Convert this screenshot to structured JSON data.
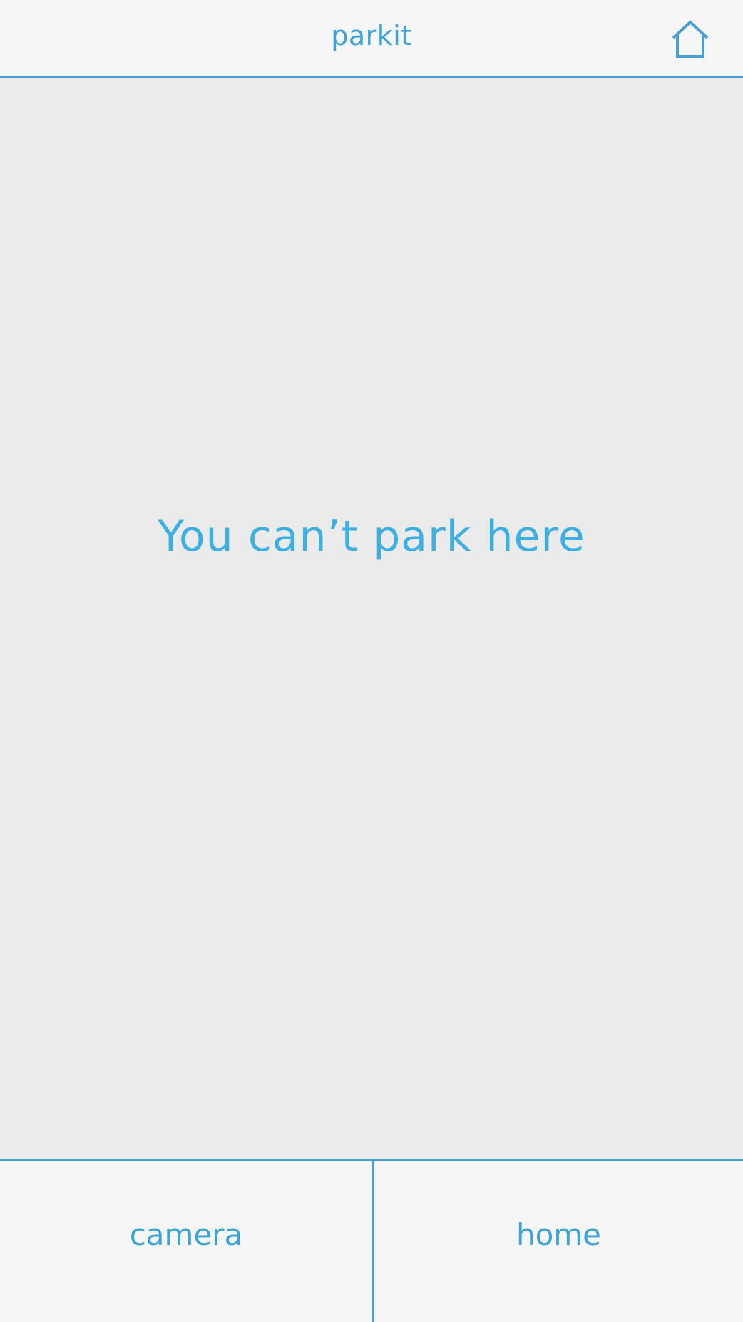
{
  "header": {
    "title": "parkit",
    "home_icon": "home-icon"
  },
  "main": {
    "message": "You can’t park here"
  },
  "footer": {
    "tabs": [
      {
        "label": "camera"
      },
      {
        "label": "home"
      }
    ]
  },
  "colors": {
    "accent": "#3aa3da",
    "divider": "#4a9fd4",
    "bar_background": "#f6f6f6",
    "content_background": "#ebebeb"
  }
}
